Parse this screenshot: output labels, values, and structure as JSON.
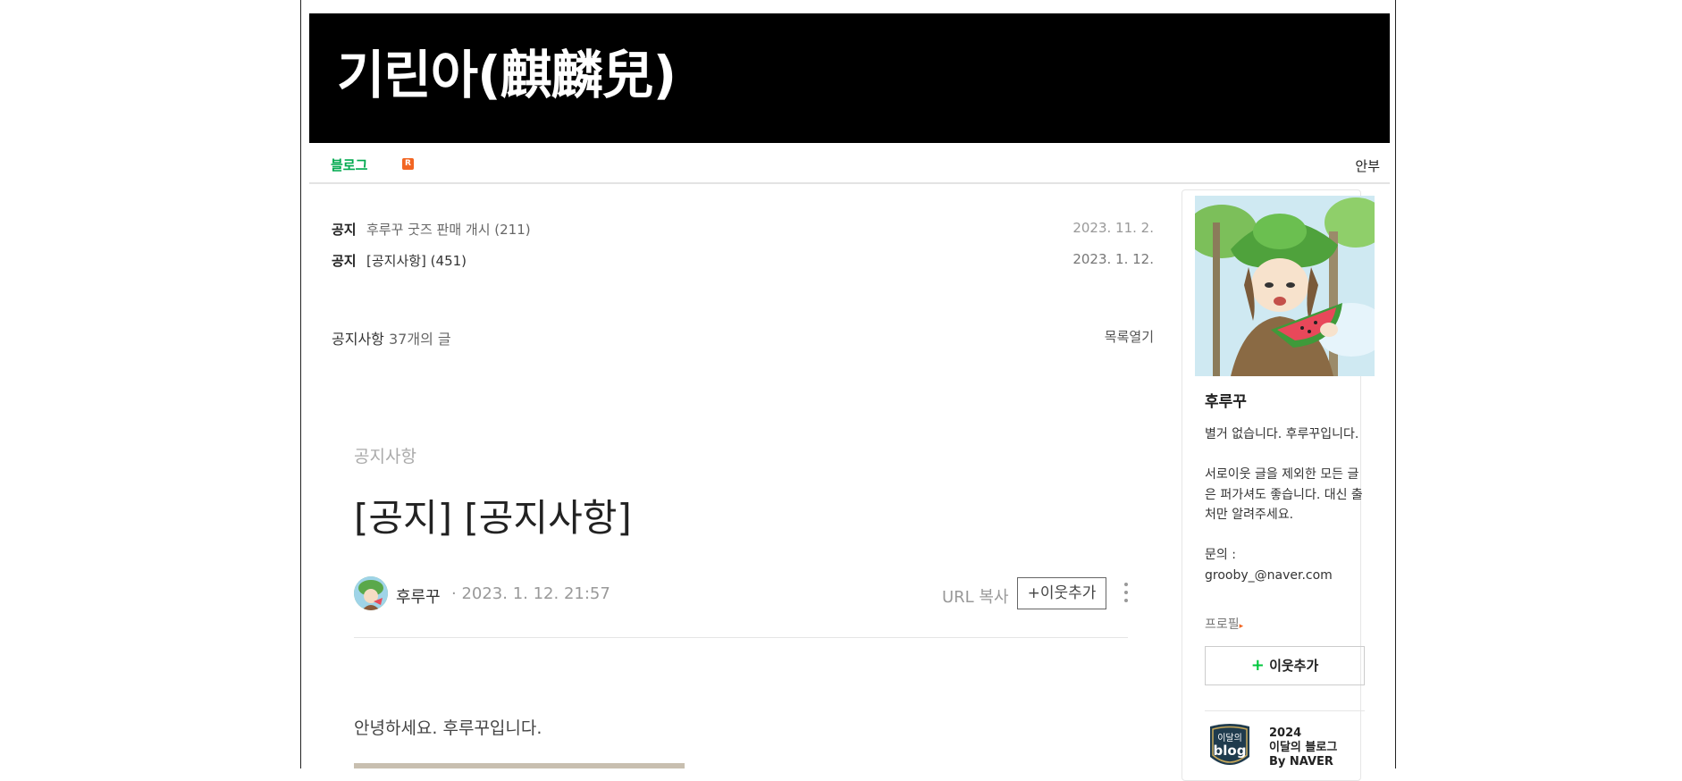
{
  "header": {
    "blog_title": "기린아(麒麟兒)"
  },
  "menu": {
    "blog_label": "블로그",
    "badge": "R",
    "intro_label": "안부"
  },
  "notices": [
    {
      "label": "공지",
      "title": "후루꾸 굿즈 판매 개시 (211)",
      "date": "2023. 11. 2."
    },
    {
      "label": "공지",
      "title": "[공지사항] (451)",
      "date": "2023. 1. 12."
    }
  ],
  "category": {
    "name": "공지사항",
    "count": "37개의 글",
    "toc_toggle": "목록열기"
  },
  "post": {
    "category": "공지사항",
    "title": "[공지] [공지사항]",
    "author": "후루꾸",
    "date": "· 2023. 1. 12. 21:57",
    "url_copy": "URL 복사",
    "neighbor_button": "+이웃추가",
    "body_first_line": "안녕하세요. 후루꾸입니다."
  },
  "sidebar": {
    "profile_name": "후루꾸",
    "profile_desc": "별거 없습니다. 후루꾸입니다.\n\n서로이웃 글을 제외한 모든 글은 퍼가셔도 좋습니다. 대신 출처만 알려주세요.\n\n문의 : grooby_@naver.com",
    "profile_link": "프로필",
    "neighbor_button": "이웃추가",
    "neighbor_plus": "+",
    "award_badge_line1": "이달의",
    "award_badge_line2": "blog",
    "award_year": "2024",
    "award_title": "이달의 블로그",
    "award_by": "By NAVER"
  },
  "colors": {
    "accent_green": "#00a94f",
    "badge_orange": "#f26522",
    "banner_bg": "#000000"
  }
}
